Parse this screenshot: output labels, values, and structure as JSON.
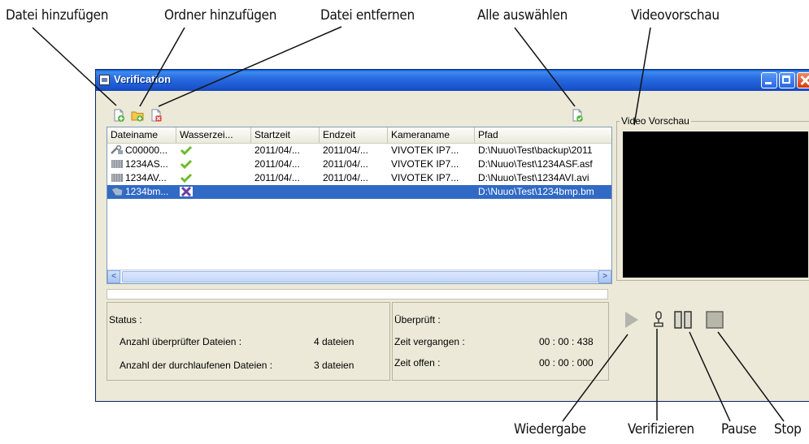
{
  "callouts": {
    "add_file": "Datei hinzufügen",
    "add_folder": "Ordner hinzufügen",
    "remove_file": "Datei entfernen",
    "select_all": "Alle auswählen",
    "video_preview": "Videovorschau",
    "play": "Wiedergabe",
    "verify": "Verifizieren",
    "pause": "Pause",
    "stop": "Stop"
  },
  "window": {
    "title": "Verification"
  },
  "table": {
    "columns": [
      "Dateiname",
      "Wasserzei...",
      "Startzeit",
      "Endzeit",
      "Kameraname",
      "Pfad"
    ],
    "rows": [
      {
        "icon": "wrench-file-icon",
        "filename": "C00000...",
        "watermark": "check",
        "start": "2011/04/...",
        "end": "2011/04/...",
        "camera": "VIVOTEK IP7...",
        "path": "D:\\Nuuo\\Test\\backup\\2011"
      },
      {
        "icon": "film-icon",
        "filename": "1234AS...",
        "watermark": "check",
        "start": "2011/04/...",
        "end": "2011/04/...",
        "camera": "VIVOTEK IP7...",
        "path": "D:\\Nuuo\\Test\\1234ASF.asf"
      },
      {
        "icon": "film-icon",
        "filename": "1234AV...",
        "watermark": "check",
        "start": "2011/04/...",
        "end": "2011/04/...",
        "camera": "VIVOTEK IP7...",
        "path": "D:\\Nuuo\\Test\\1234AVI.avi"
      },
      {
        "icon": "image-file-icon",
        "filename": "1234bm...",
        "watermark": "cross",
        "start": "",
        "end": "",
        "camera": "",
        "path": "D:\\Nuuo\\Test\\1234bmp.bm"
      }
    ]
  },
  "status": {
    "heading": "Status :",
    "checked_label": "Anzahl überprüfter Dateien :",
    "checked_value": "4  dateien",
    "processed_label": "Anzahl der durchlaufenen Dateien :",
    "processed_value": "3  dateien"
  },
  "timing": {
    "verified_label": "Überprüft :",
    "elapsed_label": "Zeit vergangen :",
    "elapsed_value": "00 : 00 : 438",
    "remaining_label": "Zeit offen :",
    "remaining_value": "00 : 00 : 000"
  },
  "preview": {
    "label": "Video Vorschau"
  },
  "colors": {
    "title_bar": "#1b58d0",
    "selection": "#316ac5",
    "check": "#6dbb2c",
    "cross": "#6b3fa0",
    "preview_bg": "#000000"
  }
}
